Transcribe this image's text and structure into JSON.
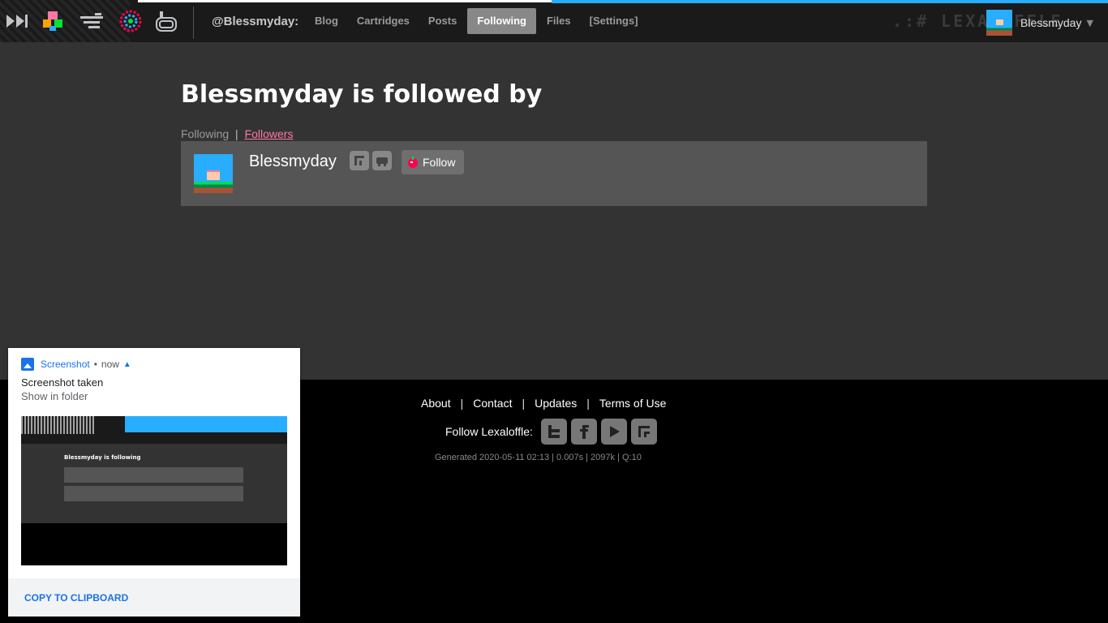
{
  "topbar": {
    "logo_icons": [
      "pico8-logo-icon",
      "voxatron-logo-icon",
      "picotron-logo-icon",
      "splore-logo-icon",
      "pocket-logo-icon"
    ],
    "user_handle": "@Blessmyday:",
    "nav": [
      {
        "label": "Blog",
        "active": false
      },
      {
        "label": "Cartridges",
        "active": false
      },
      {
        "label": "Posts",
        "active": false
      },
      {
        "label": "Following",
        "active": true
      },
      {
        "label": "Files",
        "active": false
      },
      {
        "label": "[Settings]",
        "active": false
      }
    ],
    "bg_text": ".:# LEXALOFFLE",
    "user_name": "Blessmyday",
    "accent": "#29adff"
  },
  "main": {
    "title": "Blessmyday is followed by",
    "tab_following": "Following",
    "tab_sep": "|",
    "tab_followers": "Followers",
    "card": {
      "name": "Blessmyday",
      "icons": [
        "rss-icon",
        "gamepad-icon"
      ],
      "follow_label": "Follow"
    },
    "link_color": "#ff77a8"
  },
  "footer": {
    "links": [
      "About",
      "Contact",
      "Updates",
      "Terms of Use"
    ],
    "sep": "|",
    "follow_label": "Follow Lexaloffle:",
    "social": [
      "twitter-icon",
      "facebook-icon",
      "youtube-icon",
      "rss-icon"
    ],
    "generated": "Generated 2020-05-11 02:13 | 0.007s | 2097k | Q:10"
  },
  "notification": {
    "app": "Screenshot",
    "dot": "•",
    "time": "now",
    "title": "Screenshot taken",
    "subtitle": "Show in folder",
    "thumb_title": "Blessmyday is following",
    "action": "COPY TO CLIPBOARD"
  }
}
